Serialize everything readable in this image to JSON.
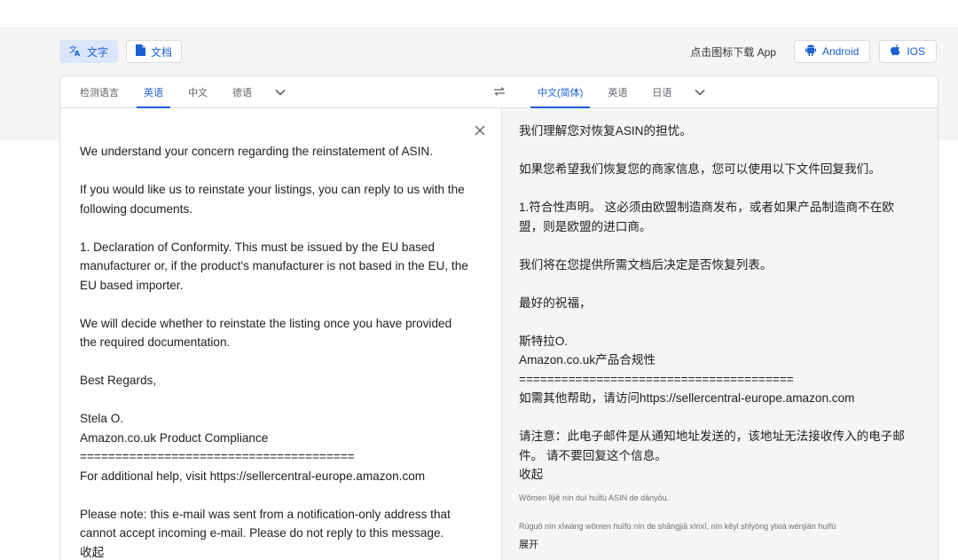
{
  "modes": {
    "text_label": "文字",
    "doc_label": "文档"
  },
  "apps": {
    "hint": "点击图标下载 App",
    "android": "Android",
    "ios": "IOS"
  },
  "source_langs": [
    "检测语言",
    "英语",
    "中文",
    "德语"
  ],
  "target_langs": [
    "中文(简体)",
    "英语",
    "日语"
  ],
  "source": {
    "paragraphs": [
      "We understand your concern regarding the reinstatement of ASIN.",
      "If you would like us to reinstate your listings, you can reply to us with the following documents.",
      "1. Declaration of Conformity. This must be issued by the EU based manufacturer or, if the product's manufacturer is not based in the EU, the EU based importer.",
      "We will decide whether to reinstate the listing once you have provided the required documentation.",
      "Best Regards,"
    ],
    "sig_name": "Stela O.",
    "sig_dept": "Amazon.co.uk Product Compliance",
    "sig_rule": "=======================================",
    "help": "For additional help, visit https://sellercentral-europe.amazon.com",
    "note": "Please note: this e-mail was sent from a notification-only address that cannot accept incoming e-mail. Please do not reply to this message.",
    "collapse": "收起"
  },
  "target": {
    "paragraphs": [
      "我们理解您对恢复ASIN的担忧。",
      "如果您希望我们恢复您的商家信息，您可以使用以下文件回复我们。",
      "1.符合性声明。 这必须由欧盟制造商发布，或者如果产品制造商不在欧盟，则是欧盟的进口商。",
      "我们将在您提供所需文档后决定是否恢复列表。",
      "最好的祝福，"
    ],
    "sig_name": "斯特拉O.",
    "sig_dept": "Amazon.co.uk产品合规性",
    "sig_rule": "=======================================",
    "help": "如需其他帮助，请访问https://sellercentral-europe.amazon.com",
    "note": "请注意：此电子邮件是从通知地址发送的，该地址无法接收传入的电子邮件。 请不要回复这个信息。",
    "collapse": "收起",
    "pinyin_1": "Wǒmen lǐjiě nín duì huīfù ASIN de dānyōu.",
    "pinyin_2": "Rúguǒ nín xīwàng wǒmen huīfù nín de shāngjiā xìnxī, nín kěyǐ shǐyòng yǐxià wénjiàn huífù",
    "expand": "展开"
  },
  "colors": {
    "accent": "#1a5fd3",
    "active_bg": "#dbe6fb",
    "panel_gray": "#f5f5f5"
  }
}
